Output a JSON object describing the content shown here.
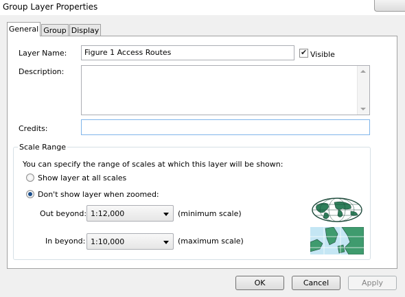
{
  "window": {
    "title": "Group Layer Properties"
  },
  "tabs": [
    {
      "label": "General",
      "selected": true
    },
    {
      "label": "Group",
      "selected": false
    },
    {
      "label": "Display",
      "selected": false
    }
  ],
  "general": {
    "layer_name_label": "Layer Name:",
    "layer_name_value": "Figure 1 Access Routes",
    "visible_label": "Visible",
    "visible_checked": true,
    "description_label": "Description:",
    "description_value": "",
    "credits_label": "Credits:",
    "credits_value": ""
  },
  "scale_range": {
    "legend": "Scale Range",
    "intro": "You can specify the range of scales at which this layer will be shown:",
    "option_all": "Show layer at all scales",
    "option_zoomed": "Don't show layer when zoomed:",
    "selected_option": "zoomed",
    "out_beyond_label": "Out beyond:",
    "out_beyond_value": "1:12,000",
    "out_beyond_note": "(minimum scale)",
    "in_beyond_label": "In beyond:",
    "in_beyond_value": "1:10,000",
    "in_beyond_note": "(maximum scale)"
  },
  "footer": {
    "ok_label": "OK",
    "cancel_label": "Cancel",
    "apply_label": "Apply"
  },
  "colors": {
    "map_land": "#3f9b6e",
    "map_water": "#c4e6f4",
    "radio_selected": "#1a4e8c"
  }
}
